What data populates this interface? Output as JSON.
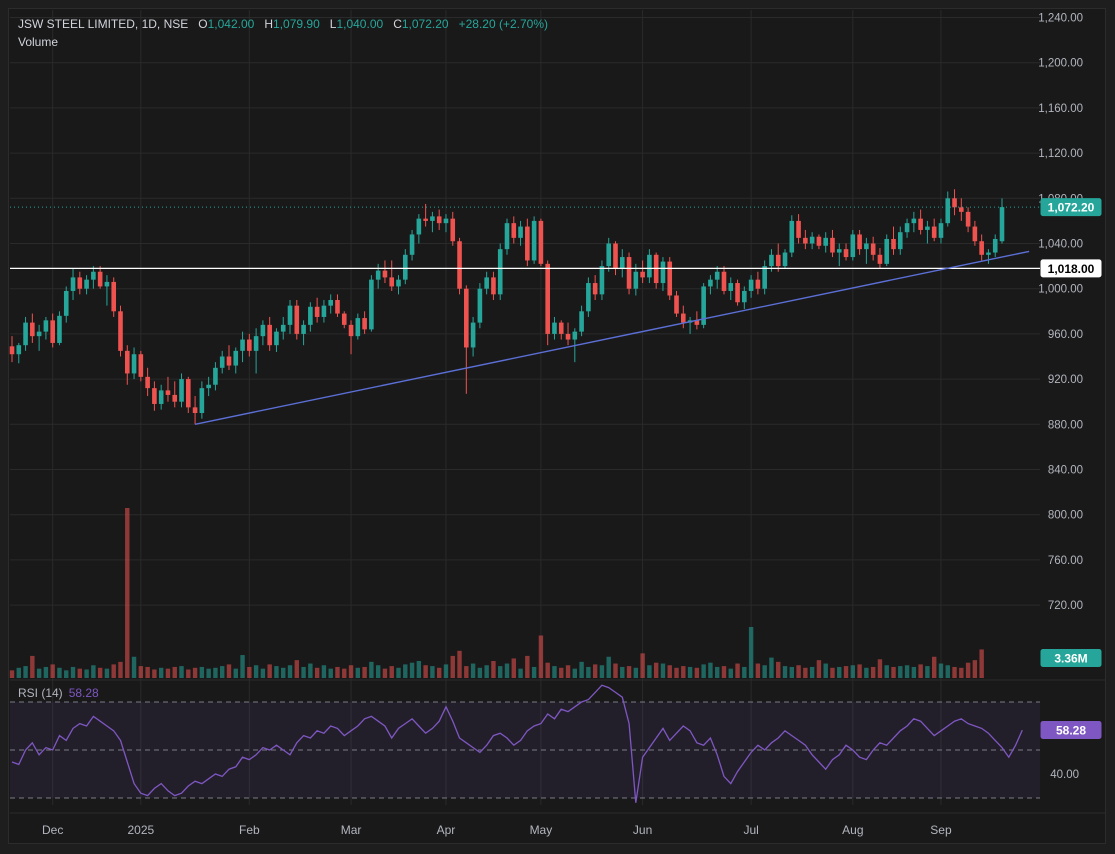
{
  "header": {
    "symbol": "JSW STEEL LIMITED, 1D, NSE",
    "o_label": "O",
    "o_value": "1,042.00",
    "h_label": "H",
    "h_value": "1,079.90",
    "l_label": "L",
    "l_value": "1,040.00",
    "c_label": "C",
    "c_value": "1,072.20",
    "change": "+28.20 (+2.70%)",
    "volume_label": "Volume"
  },
  "rsi": {
    "label": "RSI (14)",
    "value": "58.28"
  },
  "colors": {
    "up": "#26a69a",
    "down": "#ef5350",
    "rsi_line": "#7e57c2",
    "trendline": "#5b6fd6",
    "level": "#ffffff",
    "grid": "#2a2a2a"
  },
  "chart_data": {
    "type": "candlestick",
    "symbol": "JSW STEEL LIMITED",
    "interval": "1D",
    "exchange": "NSE",
    "y_axis_ticks": [
      "1,240.00",
      "1,200.00",
      "1,160.00",
      "1,120.00",
      "1,080.00",
      "1,040.00",
      "1,000.00",
      "960.00",
      "920.00",
      "880.00",
      "840.00",
      "800.00",
      "760.00",
      "720.00"
    ],
    "y_tick_values": [
      1240,
      1200,
      1160,
      1120,
      1080,
      1040,
      1000,
      960,
      920,
      880,
      840,
      800,
      760,
      720
    ],
    "ylim": [
      686,
      1252
    ],
    "x_axis_labels": [
      "Dec",
      "2025",
      "Feb",
      "Mar",
      "Apr",
      "May",
      "Jun",
      "Jul",
      "Aug",
      "Sep"
    ],
    "x_label_index": [
      6,
      19,
      35,
      50,
      64,
      78,
      93,
      109,
      124,
      137
    ],
    "price_tags": {
      "last": "1,072.20",
      "level": "1,018.00",
      "volume": "3.36M"
    },
    "last_close": 1072.2,
    "horizontal_level": 1018,
    "trendline": {
      "start": {
        "index": 27,
        "price": 880
      },
      "end": {
        "index": 150,
        "price": 1033
      }
    },
    "candles": [
      {
        "o": 949,
        "h": 958,
        "l": 935,
        "c": 942
      },
      {
        "o": 942,
        "h": 952,
        "l": 934,
        "c": 950
      },
      {
        "o": 950,
        "h": 975,
        "l": 945,
        "c": 970
      },
      {
        "o": 970,
        "h": 978,
        "l": 952,
        "c": 958
      },
      {
        "o": 958,
        "h": 968,
        "l": 945,
        "c": 962
      },
      {
        "o": 962,
        "h": 975,
        "l": 955,
        "c": 972
      },
      {
        "o": 972,
        "h": 978,
        "l": 948,
        "c": 952
      },
      {
        "o": 952,
        "h": 980,
        "l": 950,
        "c": 976
      },
      {
        "o": 976,
        "h": 1002,
        "l": 970,
        "c": 998
      },
      {
        "o": 998,
        "h": 1018,
        "l": 990,
        "c": 1010
      },
      {
        "o": 1010,
        "h": 1015,
        "l": 995,
        "c": 1000
      },
      {
        "o": 1000,
        "h": 1012,
        "l": 995,
        "c": 1008
      },
      {
        "o": 1008,
        "h": 1020,
        "l": 1000,
        "c": 1015
      },
      {
        "o": 1015,
        "h": 1020,
        "l": 1000,
        "c": 1002
      },
      {
        "o": 1002,
        "h": 1012,
        "l": 985,
        "c": 1006
      },
      {
        "o": 1006,
        "h": 1010,
        "l": 975,
        "c": 980
      },
      {
        "o": 980,
        "h": 985,
        "l": 940,
        "c": 945
      },
      {
        "o": 945,
        "h": 950,
        "l": 915,
        "c": 925
      },
      {
        "o": 925,
        "h": 948,
        "l": 920,
        "c": 942
      },
      {
        "o": 942,
        "h": 945,
        "l": 918,
        "c": 922
      },
      {
        "o": 922,
        "h": 930,
        "l": 905,
        "c": 912
      },
      {
        "o": 912,
        "h": 918,
        "l": 892,
        "c": 898
      },
      {
        "o": 898,
        "h": 915,
        "l": 893,
        "c": 910
      },
      {
        "o": 910,
        "h": 922,
        "l": 900,
        "c": 906
      },
      {
        "o": 906,
        "h": 918,
        "l": 895,
        "c": 900
      },
      {
        "o": 900,
        "h": 925,
        "l": 895,
        "c": 920
      },
      {
        "o": 920,
        "h": 922,
        "l": 890,
        "c": 895
      },
      {
        "o": 895,
        "h": 905,
        "l": 880,
        "c": 890
      },
      {
        "o": 890,
        "h": 918,
        "l": 885,
        "c": 912
      },
      {
        "o": 912,
        "h": 922,
        "l": 905,
        "c": 915
      },
      {
        "o": 915,
        "h": 935,
        "l": 910,
        "c": 930
      },
      {
        "o": 930,
        "h": 945,
        "l": 925,
        "c": 940
      },
      {
        "o": 940,
        "h": 950,
        "l": 928,
        "c": 932
      },
      {
        "o": 932,
        "h": 948,
        "l": 925,
        "c": 945
      },
      {
        "o": 945,
        "h": 962,
        "l": 935,
        "c": 955
      },
      {
        "o": 955,
        "h": 960,
        "l": 940,
        "c": 945
      },
      {
        "o": 945,
        "h": 965,
        "l": 925,
        "c": 958
      },
      {
        "o": 958,
        "h": 972,
        "l": 950,
        "c": 968
      },
      {
        "o": 968,
        "h": 975,
        "l": 945,
        "c": 950
      },
      {
        "o": 950,
        "h": 965,
        "l": 944,
        "c": 962
      },
      {
        "o": 962,
        "h": 975,
        "l": 955,
        "c": 968
      },
      {
        "o": 968,
        "h": 990,
        "l": 960,
        "c": 985
      },
      {
        "o": 985,
        "h": 990,
        "l": 955,
        "c": 960
      },
      {
        "o": 960,
        "h": 972,
        "l": 950,
        "c": 968
      },
      {
        "o": 968,
        "h": 988,
        "l": 962,
        "c": 984
      },
      {
        "o": 984,
        "h": 992,
        "l": 970,
        "c": 975
      },
      {
        "o": 975,
        "h": 990,
        "l": 970,
        "c": 985
      },
      {
        "o": 985,
        "h": 995,
        "l": 978,
        "c": 990
      },
      {
        "o": 990,
        "h": 995,
        "l": 975,
        "c": 978
      },
      {
        "o": 978,
        "h": 980,
        "l": 965,
        "c": 968
      },
      {
        "o": 968,
        "h": 972,
        "l": 942,
        "c": 958
      },
      {
        "o": 958,
        "h": 978,
        "l": 955,
        "c": 974
      },
      {
        "o": 974,
        "h": 980,
        "l": 960,
        "c": 964
      },
      {
        "o": 964,
        "h": 1012,
        "l": 962,
        "c": 1008
      },
      {
        "o": 1008,
        "h": 1022,
        "l": 1000,
        "c": 1016
      },
      {
        "o": 1016,
        "h": 1025,
        "l": 1005,
        "c": 1010
      },
      {
        "o": 1010,
        "h": 1025,
        "l": 998,
        "c": 1002
      },
      {
        "o": 1002,
        "h": 1012,
        "l": 995,
        "c": 1008
      },
      {
        "o": 1008,
        "h": 1035,
        "l": 1004,
        "c": 1030
      },
      {
        "o": 1030,
        "h": 1052,
        "l": 1025,
        "c": 1048
      },
      {
        "o": 1048,
        "h": 1066,
        "l": 1040,
        "c": 1062
      },
      {
        "o": 1062,
        "h": 1075,
        "l": 1055,
        "c": 1060
      },
      {
        "o": 1060,
        "h": 1068,
        "l": 1050,
        "c": 1064
      },
      {
        "o": 1064,
        "h": 1070,
        "l": 1052,
        "c": 1058
      },
      {
        "o": 1058,
        "h": 1066,
        "l": 1050,
        "c": 1062
      },
      {
        "o": 1062,
        "h": 1068,
        "l": 1038,
        "c": 1042
      },
      {
        "o": 1042,
        "h": 1045,
        "l": 995,
        "c": 1000
      },
      {
        "o": 1000,
        "h": 1003,
        "l": 907,
        "c": 948
      },
      {
        "o": 948,
        "h": 975,
        "l": 940,
        "c": 970
      },
      {
        "o": 970,
        "h": 1005,
        "l": 965,
        "c": 1000
      },
      {
        "o": 1000,
        "h": 1015,
        "l": 995,
        "c": 1010
      },
      {
        "o": 1010,
        "h": 1015,
        "l": 990,
        "c": 995
      },
      {
        "o": 995,
        "h": 1040,
        "l": 990,
        "c": 1035
      },
      {
        "o": 1035,
        "h": 1062,
        "l": 1030,
        "c": 1058
      },
      {
        "o": 1058,
        "h": 1064,
        "l": 1040,
        "c": 1045
      },
      {
        "o": 1045,
        "h": 1060,
        "l": 1038,
        "c": 1055
      },
      {
        "o": 1055,
        "h": 1062,
        "l": 1020,
        "c": 1025
      },
      {
        "o": 1025,
        "h": 1064,
        "l": 1022,
        "c": 1060
      },
      {
        "o": 1060,
        "h": 1062,
        "l": 1020,
        "c": 1022
      },
      {
        "o": 1022,
        "h": 1025,
        "l": 950,
        "c": 960
      },
      {
        "o": 960,
        "h": 975,
        "l": 955,
        "c": 970
      },
      {
        "o": 970,
        "h": 972,
        "l": 955,
        "c": 960
      },
      {
        "o": 960,
        "h": 970,
        "l": 950,
        "c": 955
      },
      {
        "o": 955,
        "h": 965,
        "l": 935,
        "c": 962
      },
      {
        "o": 962,
        "h": 985,
        "l": 958,
        "c": 980
      },
      {
        "o": 980,
        "h": 1010,
        "l": 975,
        "c": 1005
      },
      {
        "o": 1005,
        "h": 1012,
        "l": 990,
        "c": 995
      },
      {
        "o": 995,
        "h": 1025,
        "l": 990,
        "c": 1020
      },
      {
        "o": 1020,
        "h": 1045,
        "l": 1015,
        "c": 1040
      },
      {
        "o": 1040,
        "h": 1042,
        "l": 1012,
        "c": 1018
      },
      {
        "o": 1018,
        "h": 1035,
        "l": 1010,
        "c": 1028
      },
      {
        "o": 1028,
        "h": 1032,
        "l": 995,
        "c": 1000
      },
      {
        "o": 1000,
        "h": 1022,
        "l": 994,
        "c": 1015
      },
      {
        "o": 1015,
        "h": 1025,
        "l": 1005,
        "c": 1010
      },
      {
        "o": 1010,
        "h": 1035,
        "l": 1005,
        "c": 1030
      },
      {
        "o": 1030,
        "h": 1032,
        "l": 1000,
        "c": 1005
      },
      {
        "o": 1005,
        "h": 1028,
        "l": 998,
        "c": 1024
      },
      {
        "o": 1024,
        "h": 1028,
        "l": 990,
        "c": 994
      },
      {
        "o": 994,
        "h": 998,
        "l": 975,
        "c": 978
      },
      {
        "o": 978,
        "h": 985,
        "l": 965,
        "c": 970
      },
      {
        "o": 970,
        "h": 975,
        "l": 960,
        "c": 972
      },
      {
        "o": 972,
        "h": 980,
        "l": 964,
        "c": 968
      },
      {
        "o": 968,
        "h": 1005,
        "l": 965,
        "c": 1002
      },
      {
        "o": 1002,
        "h": 1012,
        "l": 995,
        "c": 1008
      },
      {
        "o": 1008,
        "h": 1020,
        "l": 1000,
        "c": 1015
      },
      {
        "o": 1015,
        "h": 1020,
        "l": 995,
        "c": 998
      },
      {
        "o": 998,
        "h": 1010,
        "l": 990,
        "c": 1005
      },
      {
        "o": 1005,
        "h": 1008,
        "l": 985,
        "c": 988
      },
      {
        "o": 988,
        "h": 1002,
        "l": 982,
        "c": 998
      },
      {
        "o": 998,
        "h": 1012,
        "l": 992,
        "c": 1008
      },
      {
        "o": 1008,
        "h": 1015,
        "l": 995,
        "c": 1000
      },
      {
        "o": 1000,
        "h": 1025,
        "l": 995,
        "c": 1020
      },
      {
        "o": 1020,
        "h": 1035,
        "l": 1015,
        "c": 1030
      },
      {
        "o": 1030,
        "h": 1040,
        "l": 1015,
        "c": 1020
      },
      {
        "o": 1020,
        "h": 1035,
        "l": 1018,
        "c": 1032
      },
      {
        "o": 1032,
        "h": 1065,
        "l": 1028,
        "c": 1060
      },
      {
        "o": 1060,
        "h": 1066,
        "l": 1040,
        "c": 1045
      },
      {
        "o": 1045,
        "h": 1052,
        "l": 1035,
        "c": 1040
      },
      {
        "o": 1040,
        "h": 1050,
        "l": 1035,
        "c": 1046
      },
      {
        "o": 1046,
        "h": 1048,
        "l": 1035,
        "c": 1038
      },
      {
        "o": 1038,
        "h": 1050,
        "l": 1032,
        "c": 1045
      },
      {
        "o": 1045,
        "h": 1052,
        "l": 1028,
        "c": 1032
      },
      {
        "o": 1032,
        "h": 1040,
        "l": 1020,
        "c": 1035
      },
      {
        "o": 1035,
        "h": 1040,
        "l": 1025,
        "c": 1028
      },
      {
        "o": 1028,
        "h": 1052,
        "l": 1025,
        "c": 1048
      },
      {
        "o": 1048,
        "h": 1052,
        "l": 1030,
        "c": 1035
      },
      {
        "o": 1035,
        "h": 1045,
        "l": 1022,
        "c": 1040
      },
      {
        "o": 1040,
        "h": 1046,
        "l": 1025,
        "c": 1030
      },
      {
        "o": 1030,
        "h": 1036,
        "l": 1018,
        "c": 1022
      },
      {
        "o": 1022,
        "h": 1048,
        "l": 1020,
        "c": 1044
      },
      {
        "o": 1044,
        "h": 1055,
        "l": 1030,
        "c": 1035
      },
      {
        "o": 1035,
        "h": 1055,
        "l": 1030,
        "c": 1050
      },
      {
        "o": 1050,
        "h": 1062,
        "l": 1045,
        "c": 1058
      },
      {
        "o": 1058,
        "h": 1068,
        "l": 1050,
        "c": 1062
      },
      {
        "o": 1062,
        "h": 1070,
        "l": 1048,
        "c": 1052
      },
      {
        "o": 1052,
        "h": 1060,
        "l": 1040,
        "c": 1055
      },
      {
        "o": 1055,
        "h": 1062,
        "l": 1042,
        "c": 1045
      },
      {
        "o": 1045,
        "h": 1062,
        "l": 1040,
        "c": 1058
      },
      {
        "o": 1058,
        "h": 1086,
        "l": 1055,
        "c": 1080
      },
      {
        "o": 1080,
        "h": 1088,
        "l": 1065,
        "c": 1072
      },
      {
        "o": 1072,
        "h": 1080,
        "l": 1060,
        "c": 1068
      },
      {
        "o": 1068,
        "h": 1072,
        "l": 1050,
        "c": 1055
      },
      {
        "o": 1055,
        "h": 1060,
        "l": 1038,
        "c": 1042
      },
      {
        "o": 1042,
        "h": 1048,
        "l": 1025,
        "c": 1030
      },
      {
        "o": 1030,
        "h": 1035,
        "l": 1022,
        "c": 1032
      },
      {
        "o": 1032,
        "h": 1048,
        "l": 1028,
        "c": 1044
      },
      {
        "o": 1042,
        "h": 1079.9,
        "l": 1040,
        "c": 1072.2
      }
    ],
    "volume": [
      0.9,
      1.2,
      1.4,
      2.6,
      1.1,
      1.3,
      1.6,
      1.2,
      0.9,
      1.3,
      1.1,
      1.0,
      1.5,
      1.2,
      1.1,
      1.6,
      1.9,
      20.0,
      2.5,
      1.4,
      1.3,
      1.0,
      1.2,
      1.1,
      1.3,
      1.4,
      1.0,
      1.2,
      1.3,
      1.1,
      1.2,
      1.4,
      1.6,
      1.1,
      2.7,
      1.3,
      1.5,
      1.1,
      1.6,
      1.4,
      1.2,
      1.5,
      2.1,
      1.3,
      1.7,
      1.2,
      1.5,
      1.1,
      1.3,
      1.1,
      1.5,
      1.2,
      1.3,
      1.9,
      1.5,
      1.1,
      1.4,
      1.2,
      1.6,
      1.8,
      2.0,
      1.5,
      1.4,
      1.2,
      1.6,
      2.6,
      3.2,
      1.4,
      1.7,
      1.2,
      1.5,
      2.0,
      1.4,
      1.7,
      2.3,
      1.1,
      2.6,
      1.3,
      5.0,
      1.8,
      1.4,
      1.2,
      1.5,
      1.1,
      1.9,
      1.3,
      1.6,
      1.5,
      2.5,
      1.7,
      1.3,
      1.4,
      1.2,
      2.9,
      1.5,
      1.8,
      1.7,
      1.5,
      1.2,
      1.4,
      1.3,
      1.2,
      1.6,
      1.8,
      1.3,
      1.4,
      1.1,
      1.7,
      1.3,
      6.0,
      1.7,
      1.5,
      2.4,
      1.9,
      1.4,
      1.3,
      1.5,
      1.2,
      1.3,
      2.1,
      1.7,
      1.2,
      1.3,
      1.4,
      1.5,
      1.6,
      1.2,
      1.3,
      2.2,
      1.5,
      1.3,
      1.4,
      1.5,
      1.3,
      1.6,
      1.4,
      2.5,
      1.7,
      1.5,
      1.3,
      1.2,
      1.8,
      2.1,
      3.36
    ],
    "rsi_ylim": [
      20,
      80
    ],
    "rsi_levels": [
      70,
      50,
      30
    ],
    "rsi_tick": "40.00",
    "rsi": [
      45,
      44,
      50,
      53,
      48,
      51,
      50,
      56,
      54,
      59,
      61,
      60,
      64,
      62,
      60,
      58,
      54,
      45,
      36,
      32,
      31,
      34,
      36,
      33,
      31,
      32,
      35,
      37,
      36,
      38,
      40,
      39,
      42,
      43,
      47,
      46,
      48,
      51,
      50,
      52,
      50,
      48,
      53,
      56,
      55,
      58,
      57,
      60,
      59,
      56,
      58,
      60,
      63,
      64,
      62,
      60,
      55,
      59,
      61,
      63,
      60,
      57,
      59,
      62,
      68,
      62,
      55,
      53,
      51,
      49,
      52,
      56,
      57,
      55,
      52,
      54,
      58,
      60,
      61,
      65,
      63,
      67,
      66,
      68,
      70,
      71,
      74,
      77,
      76,
      74,
      72,
      61,
      28,
      47,
      51,
      55,
      59,
      54,
      57,
      60,
      58,
      53,
      52,
      55,
      48,
      39,
      36,
      41,
      45,
      49,
      52,
      50,
      53,
      55,
      58,
      56,
      54,
      52,
      48,
      45,
      42,
      46,
      48,
      52,
      50,
      47,
      46,
      50,
      53,
      52,
      55,
      58,
      60,
      63,
      62,
      59,
      56,
      58,
      60,
      62,
      63,
      61,
      60,
      59,
      57,
      54,
      51,
      47,
      52,
      58.28
    ]
  }
}
